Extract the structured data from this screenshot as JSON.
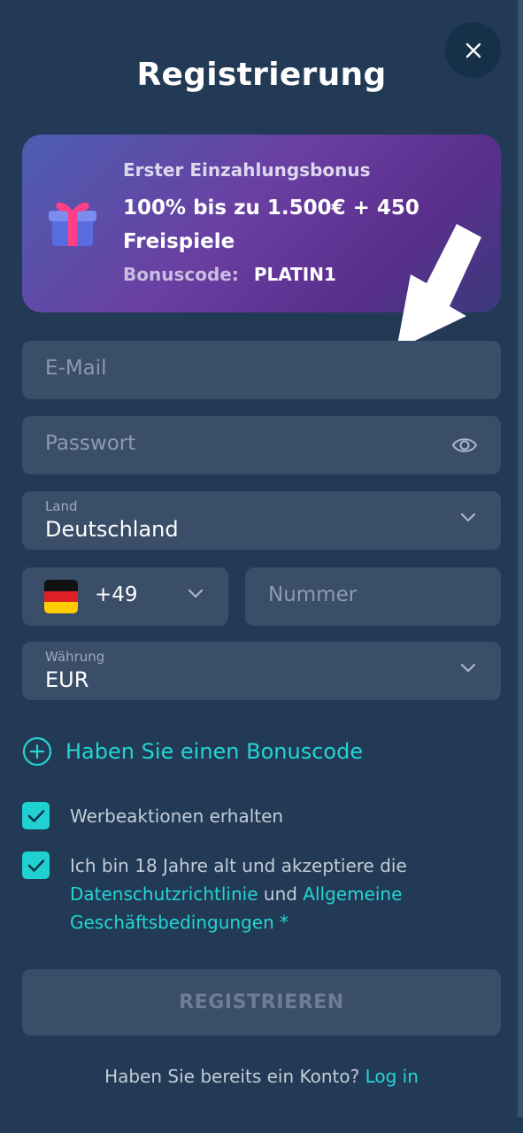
{
  "header": {
    "title": "Registrierung",
    "close_icon": "close-icon"
  },
  "bonus": {
    "headline": "Erster Einzahlungsbonus",
    "offer": "100% bis zu 1.500€ + 450 Freispiele",
    "code_label": "Bonuscode:",
    "code_value": "PLATIN1",
    "icon": "gift-icon"
  },
  "form": {
    "email_placeholder": "E-Mail",
    "password_placeholder": "Passwort",
    "country_label": "Land",
    "country_value": "Deutschland",
    "phone_code": "+49",
    "phone_placeholder": "Nummer",
    "currency_label": "Währung",
    "currency_value": "EUR"
  },
  "bonus_code_link": "Haben Sie einen Bonuscode",
  "checks": {
    "promo_label": "Werbeaktionen erhalten",
    "promo_checked": true,
    "terms_prefix": "Ich bin 18 Jahre alt und akzeptiere die",
    "privacy_link": "Datenschutzrichtlinie",
    "and_word": "und",
    "terms_link": "Allgemeine Geschäftsbedingungen",
    "required_mark": "*",
    "terms_checked": true
  },
  "register_button": "REGISTRIEREN",
  "footer": {
    "question": "Haben Sie bereits ein Konto?",
    "login_link": "Log in"
  },
  "colors": {
    "background": "#223a55",
    "field": "#3a4d69",
    "accent": "#23d5d5"
  }
}
